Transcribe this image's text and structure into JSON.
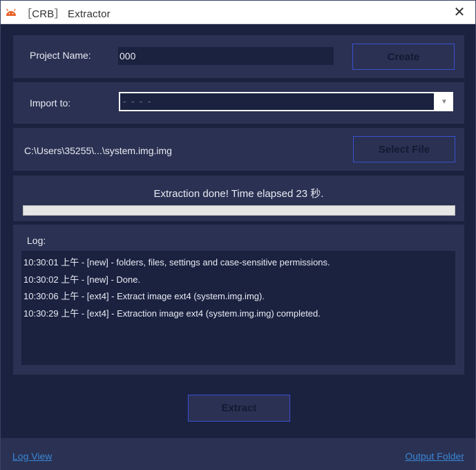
{
  "window": {
    "title": "［CRB］ Extractor",
    "app_icon": "android-icon",
    "close_glyph": "✕"
  },
  "project": {
    "label": "Project Name:",
    "value": "000",
    "create_label": "Create"
  },
  "import": {
    "label": "Import to:",
    "selected": "- - - -",
    "arrow": "▼"
  },
  "file": {
    "path": "C:\\Users\\35255\\...\\system.img.img",
    "select_label": "Select File"
  },
  "progress": {
    "status": "Extraction done! Time elapsed 23 秒.",
    "value_percent": 100
  },
  "log": {
    "label": "Log:",
    "lines": [
      "10:30:01 上午 - [new] - folders, files, settings and case-sensitive permissions.",
      "10:30:02 上午 - [new] - Done.",
      "10:30:06 上午 - [ext4] - Extract image ext4 (system.img.img).",
      "10:30:29 上午 - [ext4] - Extraction image ext4 (system.img.img) completed."
    ]
  },
  "extract_label": "Extract",
  "footer": {
    "log_view": "Log View",
    "output_folder": "Output Folder"
  },
  "colors": {
    "background": "#1b2240",
    "panel": "#2a3152",
    "button_border": "#3a51cf",
    "link": "#3a86d6",
    "android_icon": "#e8632a"
  }
}
